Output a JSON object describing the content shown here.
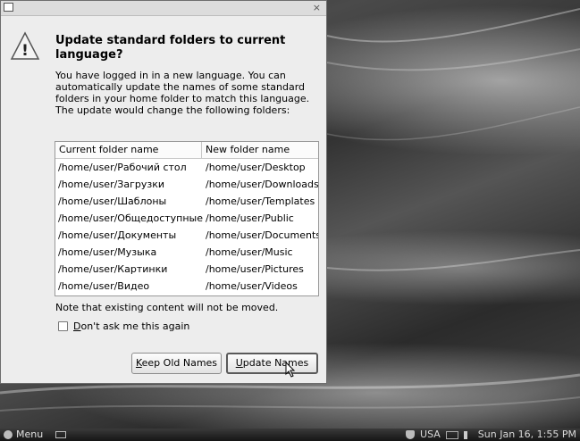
{
  "dialog": {
    "heading": "Update standard folders to current language?",
    "description": "You have logged in in a new language. You can automatically update the names of some standard folders in your home folder to match this language. The update would change the following folders:",
    "table": {
      "headers": [
        "Current folder name",
        "New folder name"
      ],
      "rows": [
        [
          "/home/user/Рабочий стол",
          "/home/user/Desktop"
        ],
        [
          "/home/user/Загрузки",
          "/home/user/Downloads"
        ],
        [
          "/home/user/Шаблоны",
          "/home/user/Templates"
        ],
        [
          "/home/user/Общедоступные",
          "/home/user/Public"
        ],
        [
          "/home/user/Документы",
          "/home/user/Documents"
        ],
        [
          "/home/user/Музыка",
          "/home/user/Music"
        ],
        [
          "/home/user/Картинки",
          "/home/user/Pictures"
        ],
        [
          "/home/user/Видео",
          "/home/user/Videos"
        ]
      ]
    },
    "note": "Note that existing content will not be moved.",
    "checkbox": {
      "mnemonic": "D",
      "rest": "on't ask me this again",
      "checked": false
    },
    "keep_button": {
      "mnemonic": "K",
      "rest": "eep Old Names"
    },
    "update_button": {
      "mnemonic": "U",
      "rest": "pdate Names"
    },
    "close_glyph": "×",
    "warning_glyph": "!"
  },
  "panel": {
    "menu_label": "Menu",
    "keyboard_layout": "USA",
    "clock": "Sun Jan 16,  1:55 PM"
  },
  "icons": {
    "app": "window-icon",
    "warning": "warning-triangle-icon",
    "close": "close-icon",
    "menu": "menu-icon",
    "show_desktop": "show-desktop-icon",
    "update_manager": "shield-icon",
    "network": "network-icon",
    "volume": "volume-icon"
  }
}
